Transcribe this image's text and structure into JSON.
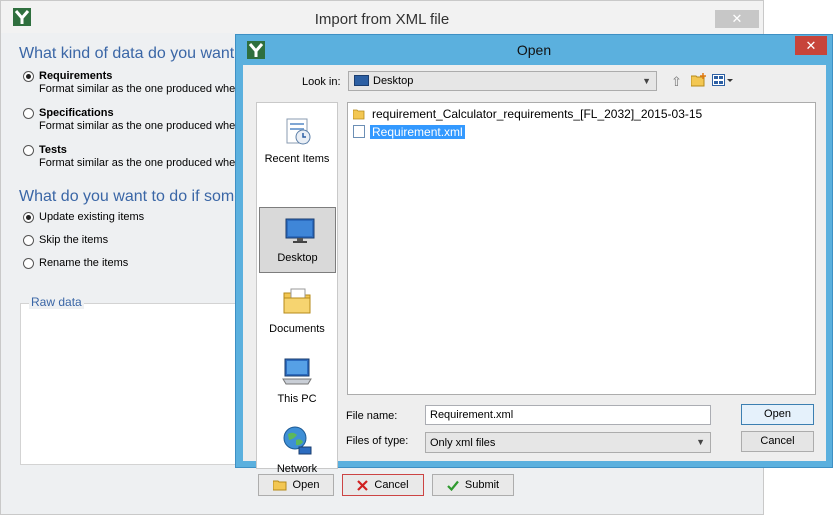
{
  "import_window": {
    "title": "Import from XML file",
    "close_glyph": "✕",
    "heading_kind": "What kind of data do you want t",
    "kind_options": [
      {
        "label": "Requirements",
        "desc": "Format similar as the one produced when",
        "checked": true
      },
      {
        "label": "Specifications",
        "desc": "Format similar as the one produced when",
        "checked": false
      },
      {
        "label": "Tests",
        "desc": "Format similar as the one produced when",
        "checked": false
      }
    ],
    "heading_conflict": "What do you want to do if some",
    "conflict_options": [
      {
        "label": "Update existing items",
        "checked": true
      },
      {
        "label": "Skip the items",
        "checked": false
      },
      {
        "label": "Rename the items",
        "checked": false
      }
    ],
    "raw_data_label": "Raw data",
    "buttons": {
      "open": "Open",
      "cancel": "Cancel",
      "submit": "Submit"
    }
  },
  "open_dialog": {
    "title": "Open",
    "close_glyph": "✕",
    "look_in_label": "Look in:",
    "look_in_value": "Desktop",
    "places": [
      "Recent Items",
      "Desktop",
      "Documents",
      "This PC",
      "Network"
    ],
    "active_place": "Desktop",
    "files": [
      {
        "name": "requirement_Calculator_requirements_[FL_2032]_2015-03-15",
        "type": "folder",
        "selected": false
      },
      {
        "name": "Requirement.xml",
        "type": "xml",
        "selected": true
      }
    ],
    "file_name_label": "File name:",
    "file_name_value": "Requirement.xml",
    "file_type_label": "Files of type:",
    "file_type_value": "Only xml files",
    "open_button": "Open",
    "cancel_button": "Cancel"
  },
  "colors": {
    "accent_blue": "#5bb0de",
    "heading_blue": "#3a66a6",
    "close_red": "#c7443a",
    "selection_blue": "#3399ff"
  },
  "icons": [
    "app-logo-icon",
    "up-folder-icon",
    "new-folder-icon",
    "view-menu-icon",
    "recent-items-icon",
    "desktop-icon",
    "documents-icon",
    "this-pc-icon",
    "network-icon",
    "folder-icon",
    "xml-file-icon"
  ]
}
